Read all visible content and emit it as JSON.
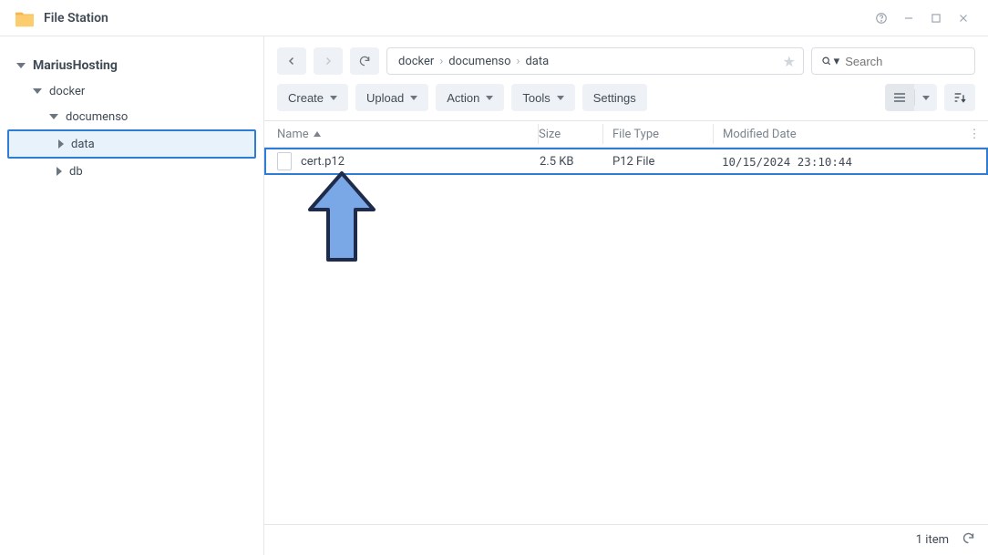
{
  "window": {
    "title": "File Station"
  },
  "tree": {
    "root": "MariusHosting",
    "lvl1": "docker",
    "lvl2": "documenso",
    "lvl3a": "data",
    "lvl3b": "db"
  },
  "breadcrumb": {
    "seg1": "docker",
    "seg2": "documenso",
    "seg3": "data"
  },
  "search": {
    "placeholder": "Search"
  },
  "actions": {
    "create": "Create",
    "upload": "Upload",
    "action": "Action",
    "tools": "Tools",
    "settings": "Settings"
  },
  "columns": {
    "name": "Name",
    "size": "Size",
    "type": "File Type",
    "date": "Modified Date"
  },
  "files": [
    {
      "name": "cert.p12",
      "size": "2.5 KB",
      "type": "P12 File",
      "date": "10/15/2024 23:10:44"
    }
  ],
  "status": {
    "count": "1 item"
  }
}
